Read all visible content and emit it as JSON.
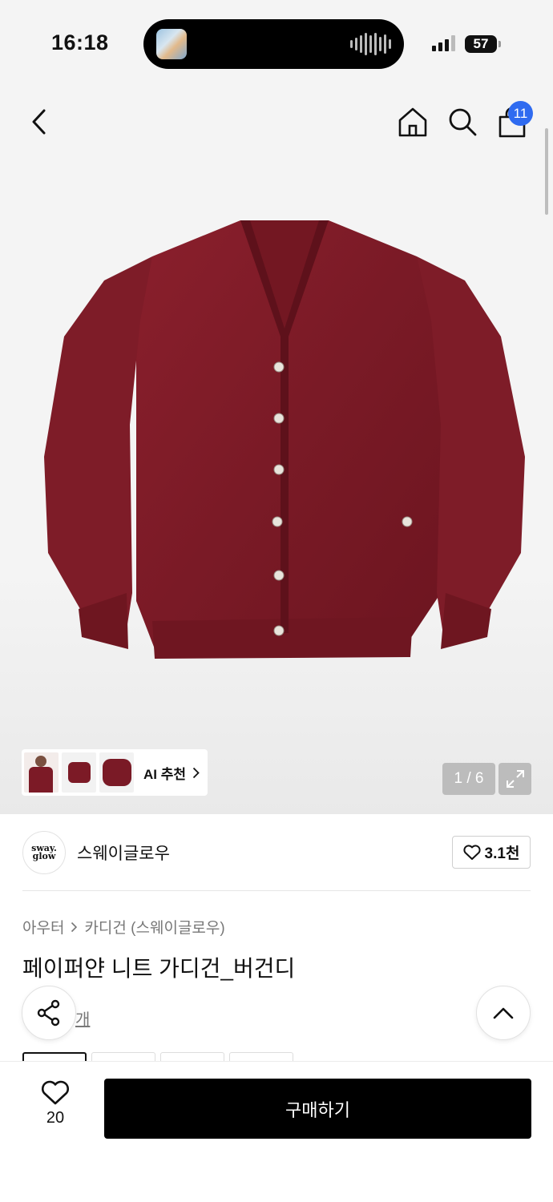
{
  "status_bar": {
    "time": "16:18",
    "battery": "57"
  },
  "nav": {
    "back_icon": "chevron-left-icon",
    "home_icon": "home-icon",
    "search_icon": "search-icon",
    "cart_icon": "shopping-bag-icon",
    "cart_count": "11"
  },
  "gallery": {
    "product_color": "#7c1a26",
    "ai_recommend_label": "AI 추천",
    "counter": "1 / 6",
    "expand_icon": "expand-icon"
  },
  "brand": {
    "logo_text_1": "sway.",
    "logo_text_2": "glow",
    "name": "스웨이글로우",
    "like_count": "3.1천"
  },
  "product": {
    "breadcrumb": [
      "아우터",
      "카디건 (스웨이글로우)"
    ],
    "title": "페이퍼얀 니트 가디건_버건디",
    "review_link": "개"
  },
  "floating": {
    "share_icon": "share-icon",
    "top_icon": "chevron-up-icon"
  },
  "bottom": {
    "wish_count": "20",
    "buy_label": "구매하기"
  },
  "colors": {
    "accent_badge": "#2f6bf0",
    "buy_button": "#000000"
  }
}
